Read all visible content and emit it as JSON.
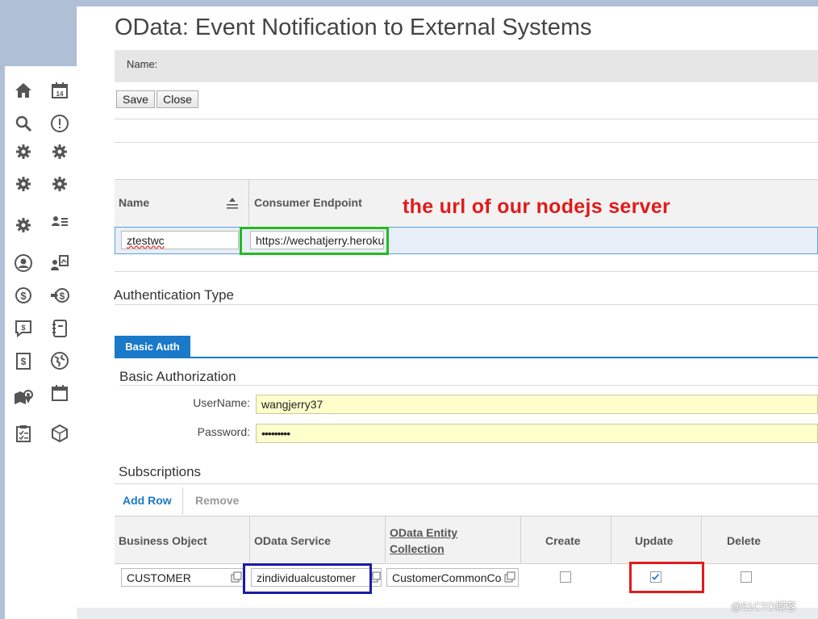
{
  "page": {
    "title": "OData: Event Notification to External Systems",
    "name_label": "Name:"
  },
  "toolbar": {
    "save_label": "Save",
    "close_label": "Close"
  },
  "endpoint_table": {
    "col_name": "Name",
    "col_endpoint": "Consumer Endpoint",
    "row": {
      "name": "ztestwc",
      "endpoint": "https://wechatjerry.heroku"
    }
  },
  "annotation": "the url of our nodejs server",
  "auth": {
    "section_title": "Authentication Type",
    "tab_label": "Basic Auth",
    "basic_title": "Basic Authorization",
    "username_label": "UserName:",
    "username_value": "wangjerry37",
    "password_label": "Password:",
    "password_value": "•••••••••"
  },
  "subscriptions": {
    "title": "Subscriptions",
    "add_row_label": "Add Row",
    "remove_label": "Remove",
    "columns": {
      "business_object": "Business Object",
      "odata_service": "OData Service",
      "entity_line1": "OData Entity",
      "entity_line2": "Collection",
      "create": "Create",
      "update": "Update",
      "delete": "Delete"
    },
    "row": {
      "business_object": "CUSTOMER",
      "odata_service": "zindividualcustomer",
      "entity_collection": "CustomerCommonCo",
      "create": false,
      "update": true,
      "delete": false
    }
  },
  "watermark": "@51CTO博客",
  "colors": {
    "highlight_green": "#22bb22",
    "highlight_blue": "#1a1aa8",
    "highlight_red": "#e01b1b",
    "tab_blue": "#1a79c8",
    "input_yellow": "#ffffcc"
  },
  "sidebar_icons": [
    "home-icon",
    "calendar-icon",
    "search-icon",
    "alert-icon",
    "gear-icon",
    "gear-icon",
    "gear-icon",
    "gear-icon",
    "gear-icon",
    "user-list-icon",
    "user-circle-icon",
    "user-report-icon",
    "dollar-icon",
    "dollar-transfer-icon",
    "message-icon",
    "notebook-icon",
    "dollar-document-icon",
    "globe-icon",
    "map-pin-icon",
    "calendar-blank-icon",
    "clipboard-icon",
    "cube-icon"
  ]
}
